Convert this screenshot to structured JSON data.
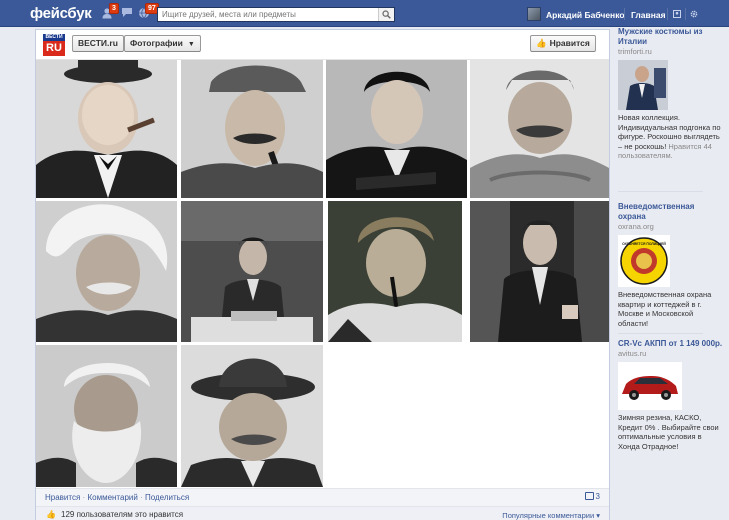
{
  "topbar": {
    "logo": "фейсбук",
    "friend_requests_count": "3",
    "notifications_count": "97",
    "search_placeholder": "Ищите друзей, места или предметы",
    "user_name": "Аркадий Бабченко",
    "home_label": "Главная"
  },
  "page": {
    "logo_small": "ВЕСТИ",
    "logo_big": "RU",
    "page_name": "ВЕСТИ.ru",
    "album_label": "Фотографии",
    "like_button": "Нравится"
  },
  "post": {
    "action_like": "Нравится",
    "action_comment": "Комментарий",
    "action_share": "Поделиться",
    "comment_count": "3",
    "likes_text": "129 пользователям это нравится",
    "popular_comments": "Популярные комментарии"
  },
  "ads": [
    {
      "title": "Мужские костюмы из Италии",
      "domain": "trimforti.ru",
      "text": "Новая коллекция. Индивидуальная подгонка по фигуре. Роскошно выглядеть – не роскошь!",
      "likes": "Нравится 44 пользователям."
    },
    {
      "title": "Вневедомственная охрана",
      "domain": "oxrana.org",
      "text": "Вневедомственная охрана квартир и коттеджей в г. Москве и Московской области!",
      "badge_text": "ОХРАНЯЕТСЯ ПОЛИЦИЕЙ"
    },
    {
      "title": "CR-Vс АКПП от 1 149 000р.",
      "domain": "avitus.ru",
      "text": "Зимняя резина, КАСКО, Кредит 0% . Выбирайте свои оптимальные условия в Хонда Отрадное!"
    }
  ],
  "colors": {
    "brand_blue": "#3b5998",
    "badge_red": "#dd3c10",
    "vesti_red": "#d92a1c"
  }
}
